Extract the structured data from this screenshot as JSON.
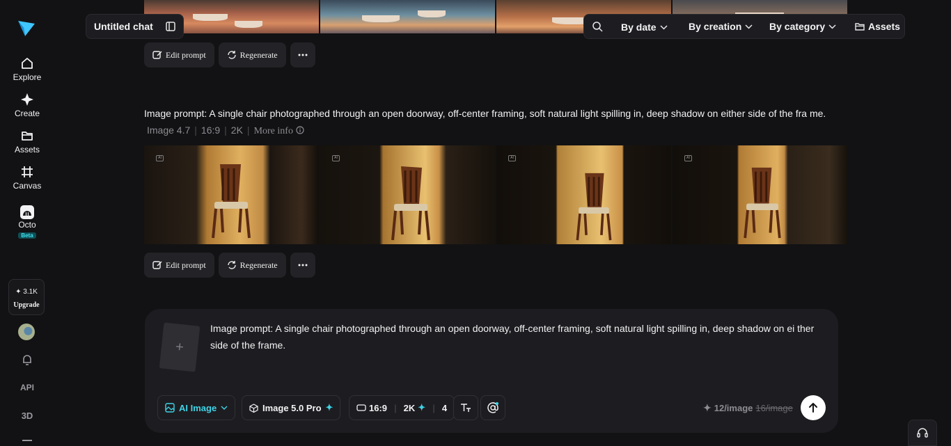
{
  "header": {
    "chat_title": "Untitled chat",
    "search_icon": "search-icon",
    "filters": [
      "By date",
      "By creation",
      "By category"
    ],
    "assets_label": "Assets"
  },
  "sidebar": {
    "items": [
      {
        "label": "Explore",
        "icon": "home-icon"
      },
      {
        "label": "Create",
        "icon": "sparkle-icon"
      },
      {
        "label": "Assets",
        "icon": "folder-icon"
      },
      {
        "label": "Canvas",
        "icon": "canvas-icon"
      },
      {
        "label": "Octo",
        "icon": "octo-icon",
        "badge": "Beta"
      }
    ],
    "credits": "3.1K",
    "upgrade_label": "Upgrade",
    "api_label": "API",
    "three_d_label": "3D"
  },
  "previous_result": {
    "edit_label": "Edit prompt",
    "regenerate_label": "Regenerate"
  },
  "result": {
    "prompt_prefix": "Image prompt: ",
    "prompt": "A single chair photographed through an open doorway, off-center framing, soft natural light spilling in, deep shadow on either side of the fra me.",
    "model": "Image 4.7",
    "ratio": "16:9",
    "resolution": "2K",
    "more_info": "More info",
    "ai_badge": "AI",
    "edit_label": "Edit prompt",
    "regenerate_label": "Regenerate"
  },
  "composer": {
    "text": "Image prompt: A single chair photographed through an open doorway, off-center framing, soft natural light spilling in, deep shadow on ei ther side of the frame.",
    "upload_symbol": "+",
    "mode": "AI Image",
    "model": "Image 5.0 Pro",
    "ratio": "16:9",
    "resolution": "2K",
    "count": "4",
    "cost": "12/image",
    "cost_original": "16/image"
  },
  "colors": {
    "accent": "#3fd3e6",
    "background": "#121214",
    "panel": "#1d1d21"
  }
}
